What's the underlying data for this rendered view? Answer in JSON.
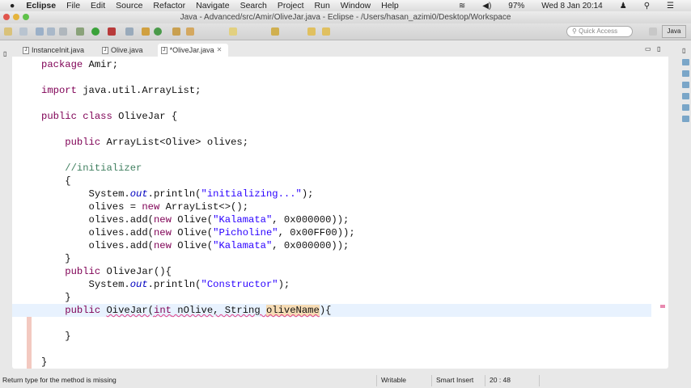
{
  "menubar": {
    "apple": "",
    "app": "Eclipse",
    "items": [
      "File",
      "Edit",
      "Source",
      "Refactor",
      "Navigate",
      "Search",
      "Project",
      "Run",
      "Window",
      "Help"
    ],
    "battery": "97%",
    "clock": "Wed 8 Jan  20:14"
  },
  "window": {
    "title": "Java - Advanced/src/Amir/OliveJar.java - Eclipse - /Users/hasan_azimi0/Desktop/Workspace"
  },
  "toolbar": {
    "quick_access_placeholder": "Quick Access",
    "perspective": "Java"
  },
  "tabs": [
    {
      "label": "InstanceInit.java",
      "active": false
    },
    {
      "label": "Olive.java",
      "active": false
    },
    {
      "label": "*OliveJar.java",
      "active": true,
      "close": "✕"
    }
  ],
  "code": [
    [
      {
        "t": "package",
        "c": "kw"
      },
      {
        "t": " Amir;"
      }
    ],
    [],
    [
      {
        "t": "import",
        "c": "kw"
      },
      {
        "t": " java.util.ArrayList;"
      }
    ],
    [],
    [
      {
        "t": "public class",
        "c": "kw"
      },
      {
        "t": " OliveJar {"
      }
    ],
    [],
    [
      {
        "t": "    "
      },
      {
        "t": "public",
        "c": "kw"
      },
      {
        "t": " ArrayList<Olive> "
      },
      {
        "t": "olives",
        "c": "fldn"
      },
      {
        "t": ";"
      }
    ],
    [],
    [
      {
        "t": "    "
      },
      {
        "t": "//initializer",
        "c": "cm"
      }
    ],
    [
      {
        "t": "    {"
      }
    ],
    [
      {
        "t": "        System."
      },
      {
        "t": "out",
        "c": "fld"
      },
      {
        "t": ".println("
      },
      {
        "t": "\"initializing...\"",
        "c": "str"
      },
      {
        "t": ");"
      }
    ],
    [
      {
        "t": "        olives = "
      },
      {
        "t": "new",
        "c": "kw"
      },
      {
        "t": " ArrayList<>();"
      }
    ],
    [
      {
        "t": "        olives.add("
      },
      {
        "t": "new",
        "c": "kw"
      },
      {
        "t": " Olive("
      },
      {
        "t": "\"Kalamata\"",
        "c": "str"
      },
      {
        "t": ", 0x000000));"
      }
    ],
    [
      {
        "t": "        olives.add("
      },
      {
        "t": "new",
        "c": "kw"
      },
      {
        "t": " Olive("
      },
      {
        "t": "\"Picholine\"",
        "c": "str"
      },
      {
        "t": ", 0x00FF00));"
      }
    ],
    [
      {
        "t": "        olives.add("
      },
      {
        "t": "new",
        "c": "kw"
      },
      {
        "t": " Olive("
      },
      {
        "t": "\"Kalamata\"",
        "c": "str"
      },
      {
        "t": ", 0x000000));"
      }
    ],
    [
      {
        "t": "    }"
      }
    ],
    [
      {
        "t": "    "
      },
      {
        "t": "public",
        "c": "kw"
      },
      {
        "t": " OliveJar(){"
      }
    ],
    [
      {
        "t": "        System."
      },
      {
        "t": "out",
        "c": "fld"
      },
      {
        "t": ".println("
      },
      {
        "t": "\"Constructor\"",
        "c": "str"
      },
      {
        "t": ");"
      }
    ],
    [
      {
        "t": "    }"
      }
    ],
    [
      {
        "t": "    "
      },
      {
        "t": "public",
        "c": "kw"
      },
      {
        "t": " "
      },
      {
        "t": "OiveJar(",
        "c": "err"
      },
      {
        "t": "int",
        "c": "kw err"
      },
      {
        "t": " nOlive, String ",
        "c": "err"
      },
      {
        "t": "oliveName",
        "c": "err hl"
      },
      {
        "t": "){"
      }
    ],
    [],
    [
      {
        "t": "    }"
      }
    ],
    [],
    [
      {
        "t": "}"
      }
    ]
  ],
  "current_line": 19,
  "status": {
    "message": "Return type for the method is missing",
    "writable": "Writable",
    "insert_mode": "Smart Insert",
    "position": "20 : 48"
  }
}
